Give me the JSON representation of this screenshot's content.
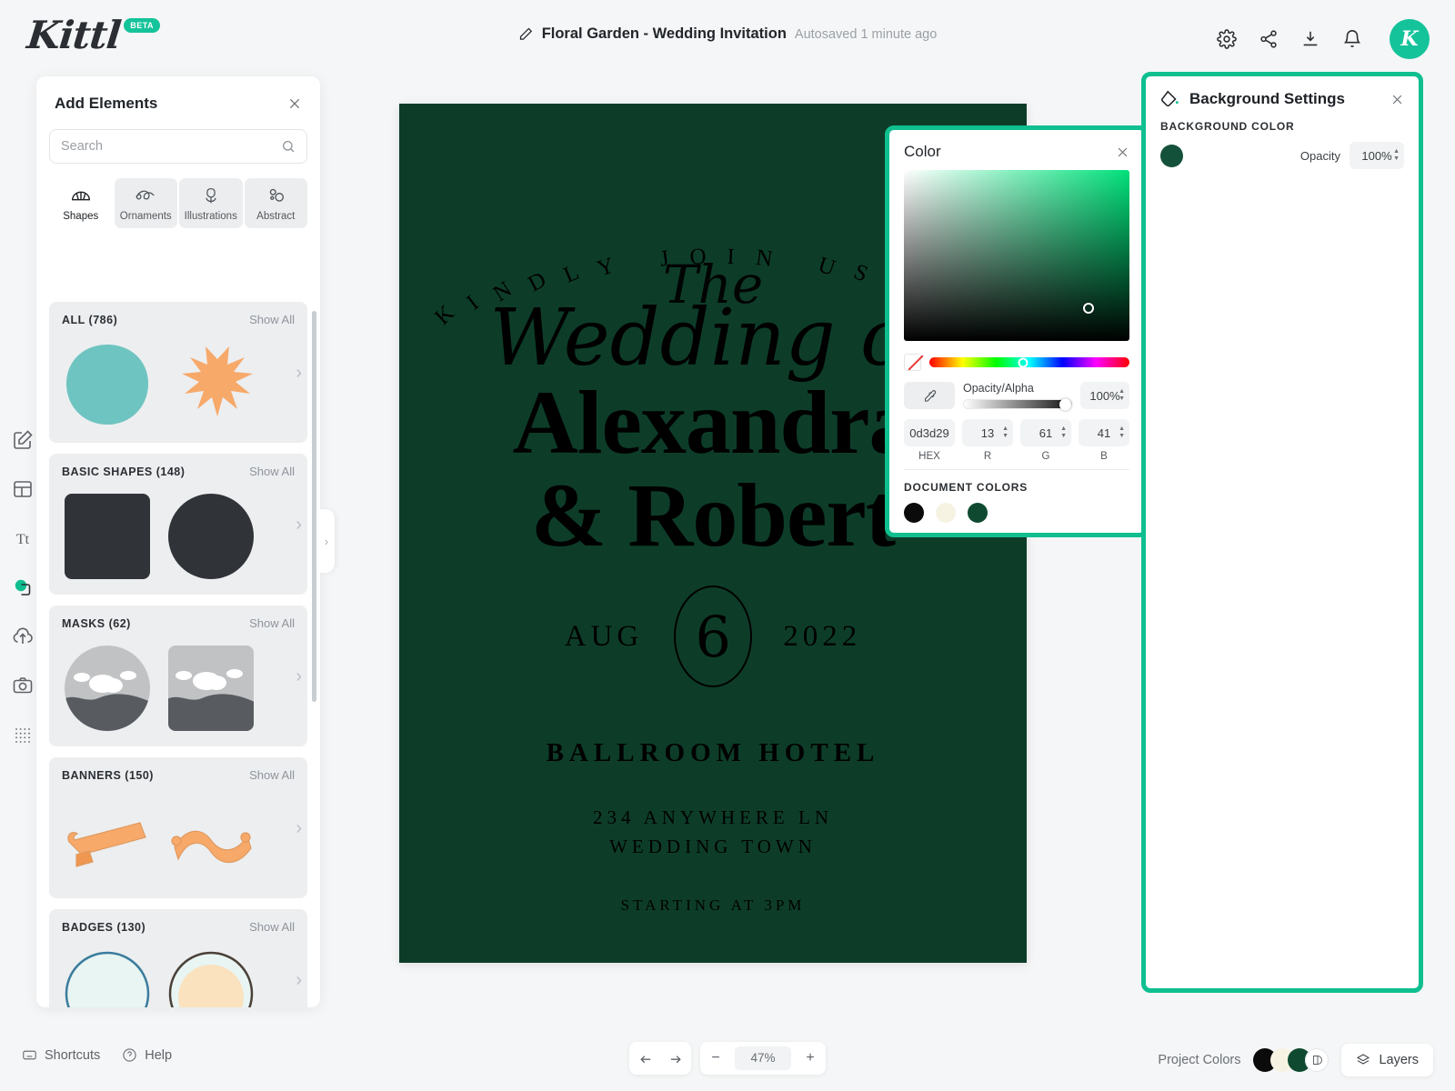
{
  "app": {
    "brand": "Kittl",
    "brand_badge": "BETA",
    "accent": "#15c39a",
    "highlight_border": "#0fbf8f"
  },
  "header": {
    "document_title": "Floral Garden - Wedding Invitation",
    "autosave_status": "Autosaved 1 minute ago",
    "pencil_icon": "pencil-icon",
    "actions": [
      {
        "name": "settings-icon",
        "label": "Settings"
      },
      {
        "name": "share-icon",
        "label": "Share"
      },
      {
        "name": "download-icon",
        "label": "Download"
      },
      {
        "name": "notifications-icon",
        "label": "Notifications"
      }
    ],
    "avatar_initial": "K"
  },
  "left_rail": {
    "items": [
      {
        "name": "design-icon",
        "label": "Design",
        "active": false
      },
      {
        "name": "templates-icon",
        "label": "Templates",
        "active": false
      },
      {
        "name": "text-icon",
        "label": "Text",
        "active": false
      },
      {
        "name": "elements-icon",
        "label": "Elements",
        "active": true
      },
      {
        "name": "uploads-icon",
        "label": "Uploads",
        "active": false
      },
      {
        "name": "photos-icon",
        "label": "Photos",
        "active": false
      },
      {
        "name": "patterns-icon",
        "label": "Patterns",
        "active": false
      }
    ]
  },
  "elements_panel": {
    "title": "Add Elements",
    "close_label": "Close",
    "search": {
      "placeholder": "Search",
      "value": ""
    },
    "tabs": [
      {
        "label": "Shapes",
        "icon": "shapes-icon",
        "active": true
      },
      {
        "label": "Ornaments",
        "icon": "ornaments-icon",
        "active": false
      },
      {
        "label": "Illustrations",
        "icon": "illustrations-icon",
        "active": false
      },
      {
        "label": "Abstract",
        "icon": "abstract-icon",
        "active": false
      }
    ],
    "show_all_label": "Show All",
    "sections": [
      {
        "title": "ALL (786)",
        "kind": "all"
      },
      {
        "title": "BASIC SHAPES (148)",
        "kind": "basic"
      },
      {
        "title": "MASKS (62)",
        "kind": "masks"
      },
      {
        "title": "BANNERS (150)",
        "kind": "banners"
      },
      {
        "title": "BADGES (130)",
        "kind": "badges"
      }
    ]
  },
  "artboard": {
    "background_color": "#0d3d29",
    "text_color": "#000000",
    "arc_text": "KINDLY JOIN US FOR",
    "script_small": "The",
    "script_large": "Wedding of",
    "name_line1": "Alexandra",
    "name_line2": "& Robert",
    "date_month": "AUG",
    "date_day": "6",
    "date_year": "2022",
    "venue": "BALLROOM HOTEL",
    "address_line1": "234 ANYWHERE LN",
    "address_line2": "WEDDING TOWN",
    "time": "STARTING AT 3PM"
  },
  "color_picker": {
    "title": "Color",
    "close_label": "Close",
    "opacity_label": "Opacity/Alpha",
    "opacity_value": "100%",
    "hex_value": "0d3d29",
    "hex_label": "HEX",
    "r_value": "13",
    "r_label": "R",
    "g_value": "61",
    "g_label": "G",
    "b_value": "41",
    "b_label": "B",
    "eyedropper_icon": "eyedropper-icon",
    "no_color_icon": "no-color-icon",
    "document_colors_label": "DOCUMENT COLORS",
    "document_colors": [
      "#0b0b0b",
      "#f7f3e3",
      "#0f4a30"
    ]
  },
  "background_settings": {
    "title": "Background Settings",
    "icon": "paint-bucket-icon",
    "close_label": "Close",
    "section_label": "BACKGROUND COLOR",
    "color": "#14513a",
    "opacity_label": "Opacity",
    "opacity_value": "100%"
  },
  "bottom_bar": {
    "shortcuts_label": "Shortcuts",
    "shortcuts_icon": "keyboard-icon",
    "help_label": "Help",
    "help_icon": "question-icon",
    "undo_icon": "undo-icon",
    "redo_icon": "redo-icon",
    "zoom_out_label": "−",
    "zoom_value": "47%",
    "zoom_in_label": "+",
    "project_colors_label": "Project Colors",
    "project_colors": [
      "#0b0b0b",
      "#f7f3e3",
      "#0f4a30"
    ],
    "layers_label": "Layers",
    "layers_icon": "layers-icon"
  }
}
